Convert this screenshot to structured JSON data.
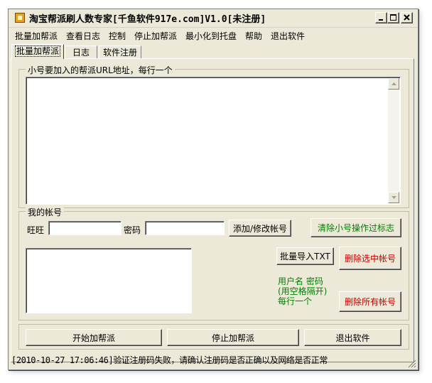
{
  "window": {
    "title": "淘宝帮派刷人数专家[千鱼软件917e.com]V1.0[未注册]"
  },
  "menu": [
    "批量加帮派",
    "查看日志",
    "控制",
    "停止加帮派",
    "最小化到托盘",
    "帮助",
    "退出软件"
  ],
  "tabs": [
    "批量加帮派",
    "日志",
    "软件注册"
  ],
  "active_tab": "批量加帮派",
  "url_group": {
    "label": "小号要加入的帮派URL地址，每行一个",
    "value": ""
  },
  "account_group": {
    "label": "我的帐号",
    "wangwang_label": "旺旺",
    "wangwang_value": "",
    "password_label": "密码",
    "password_value": "",
    "add_edit_button": "添加/修改帐号",
    "clear_flag_button": "清除小号操作过标志",
    "batch_import_button": "批量导入TXT",
    "delete_selected_button": "删除选中帐号",
    "delete_all_button": "删除所有帐号",
    "hint_lines": [
      "用户名 密码",
      "(用空格隔开)",
      "每行一个"
    ],
    "accounts_list": ""
  },
  "controls": {
    "start_button": "开始加帮派",
    "stop_button": "停止加帮派",
    "exit_button": "退出软件"
  },
  "status_text": "[2010-10-27 17:06:46]验证注册码失败，请确认注册码是否正确以及网络是否正常",
  "colors": {
    "window_bg": "#ece9d8",
    "green_text": "#008000",
    "red_text": "#c00000"
  }
}
